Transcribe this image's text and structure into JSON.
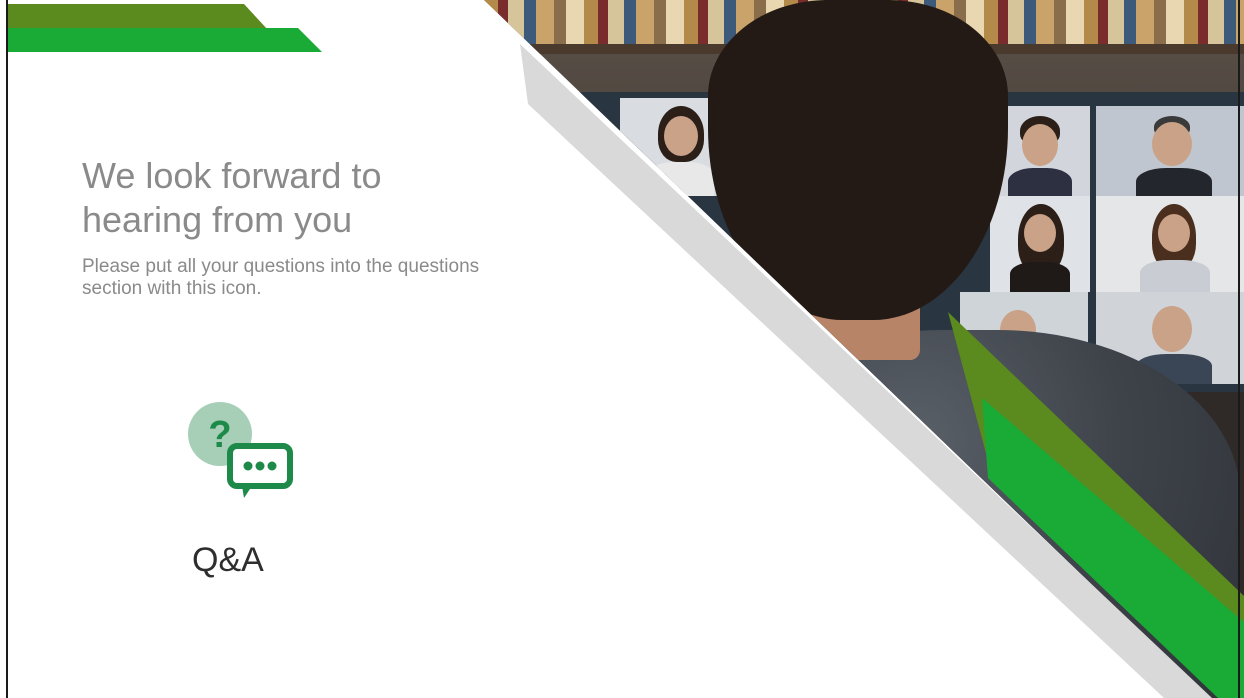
{
  "slide": {
    "title": "We look forward to hearing from you",
    "subtitle": "Please put all your questions into the questions section with this icon."
  },
  "qa": {
    "icon": "qa-chat-bubble-icon",
    "label": "Q&A"
  },
  "colors": {
    "title_gray": "#8a8a8a",
    "accent_green": "#1aab36",
    "accent_olive": "#5b8a1e",
    "diagonal_gray": "#d9d9d9",
    "icon_green": "#1e8a4a",
    "icon_circle": "#a7cfb8"
  }
}
